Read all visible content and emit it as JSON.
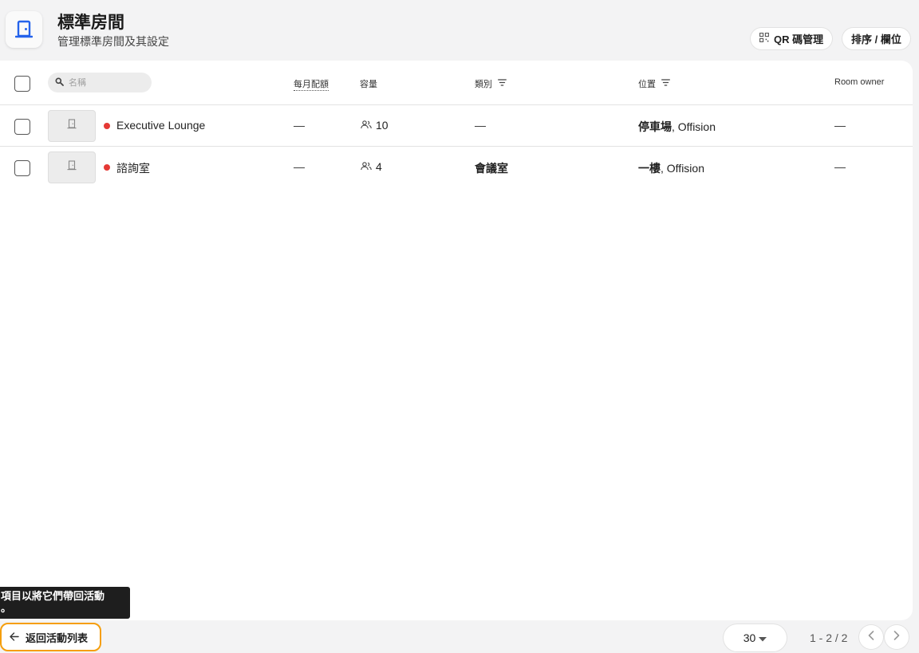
{
  "header": {
    "title": "標準房間",
    "subtitle": "管理標準房間及其設定",
    "qr_button": "QR 碼管理",
    "sort_button": "排序 / 欄位"
  },
  "table": {
    "search_placeholder": "名稱",
    "columns": {
      "monthly_quota": "每月配額",
      "capacity": "容量",
      "category": "類別",
      "location": "位置",
      "room_owner": "Room owner"
    },
    "rows": [
      {
        "name": "Executive Lounge",
        "status_color": "#e53935",
        "monthly_quota": "—",
        "capacity": "10",
        "category": "—",
        "location_primary": "停車場",
        "location_secondary": ", Offision",
        "room_owner": "—"
      },
      {
        "name": "諮詢室",
        "status_color": "#e53935",
        "monthly_quota": "—",
        "capacity": "4",
        "category": "會議室",
        "location_primary": "一樓",
        "location_secondary": ", Offision",
        "room_owner": "—"
      }
    ]
  },
  "tooltip": {
    "line1": "項目以將它們帶回活動",
    "line2": "。"
  },
  "footer": {
    "back_button": "返回活動列表",
    "page_size": "30",
    "range": "1 - 2 / 2"
  },
  "icons": {
    "app": "door-icon",
    "qr": "qr-code-icon",
    "search": "search-icon",
    "filter": "filter-icon",
    "people": "people-icon",
    "thumbnail": "door-icon",
    "back": "arrow-left-icon",
    "dropdown": "caret-down-icon",
    "prev": "chevron-left-icon",
    "next": "chevron-right-icon"
  },
  "colors": {
    "accent": "#2563eb",
    "focus_ring": "#f59e0b",
    "status_dot": "#e53935"
  }
}
